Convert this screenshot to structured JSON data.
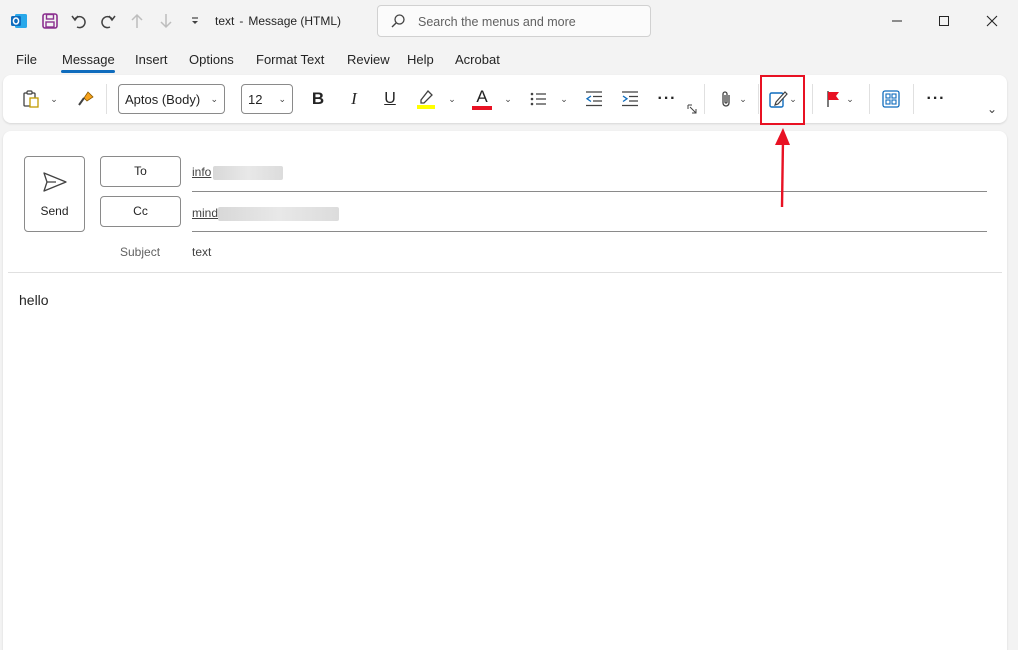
{
  "window": {
    "title": "text",
    "title_separator": "-",
    "title_type": "Message (HTML)"
  },
  "search": {
    "placeholder": "Search the menus and more"
  },
  "menu": {
    "tabs": [
      {
        "label": "File"
      },
      {
        "label": "Message",
        "active": true
      },
      {
        "label": "Insert"
      },
      {
        "label": "Options"
      },
      {
        "label": "Format Text"
      },
      {
        "label": "Review"
      },
      {
        "label": "Help"
      },
      {
        "label": "Acrobat"
      }
    ]
  },
  "ribbon": {
    "font_name": "Aptos (Body)",
    "font_size": "12",
    "bold_label": "B",
    "italic_label": "I",
    "underline_label": "U",
    "font_color_label": "A",
    "more_label": "···",
    "highlight_color": "#ffff00",
    "font_color": "#e81123",
    "icons": [
      "paste-icon",
      "format-painter-icon",
      "highlight-icon",
      "font-color-icon",
      "bullets-icon",
      "decrease-indent-icon",
      "increase-indent-icon",
      "more-icon",
      "attach-icon",
      "signature-icon",
      "flag-icon",
      "apps-icon"
    ]
  },
  "compose": {
    "send_label": "Send",
    "to_label": "To",
    "cc_label": "Cc",
    "to_value": "info",
    "cc_value": "mind",
    "subject_label": "Subject",
    "subject_value": "text",
    "body": "hello"
  },
  "colors": {
    "accent": "#0f6cbd",
    "annotation": "#e81123",
    "outlook_blue": "#0f6cbd",
    "save_purple": "#8b2f8f"
  }
}
